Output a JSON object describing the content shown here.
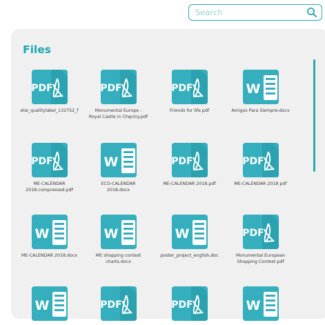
{
  "search": {
    "placeholder": "Search"
  },
  "section": {
    "title": "Files"
  },
  "files": [
    {
      "name": "etw_qualitylabel_132752_f",
      "type": "pdf"
    },
    {
      "name": "Monumental Europe -\nRoyal Castle in Chęciny.pdf",
      "type": "pdf"
    },
    {
      "name": "Friends for life.pdf",
      "type": "pdf"
    },
    {
      "name": "Amigos Para Siempre.docx",
      "type": "docx"
    },
    {
      "name": "ME-CALENDAR\n2018.compressed.pdf",
      "type": "pdf"
    },
    {
      "name": "ECO-CALENDAR\n2018.docx",
      "type": "docx"
    },
    {
      "name": "ME-CALENDAR 2018.pdf",
      "type": "pdf"
    },
    {
      "name": "ME-CALENDAR 2018 pdf",
      "type": "pdf"
    },
    {
      "name": "ME-CALENDAR 2018.docx",
      "type": "docx"
    },
    {
      "name": "ME shopping contest\ncharts.docx",
      "type": "docx"
    },
    {
      "name": "poster_project_english.doc",
      "type": "docx"
    },
    {
      "name": "Monumental European\nShopping Contest.pdf",
      "type": "pdf"
    },
    {
      "name": "",
      "type": "docx"
    },
    {
      "name": "",
      "type": "pdf"
    },
    {
      "name": "",
      "type": "pdf"
    },
    {
      "name": "",
      "type": "docx"
    }
  ],
  "colors": {
    "accent": "#2aa7b3",
    "icon_fill": "#35afbd",
    "panel": "#f0f0f0"
  },
  "icons": {
    "pdf": "pdf-file-icon",
    "docx": "word-file-icon",
    "search": "search-icon"
  }
}
